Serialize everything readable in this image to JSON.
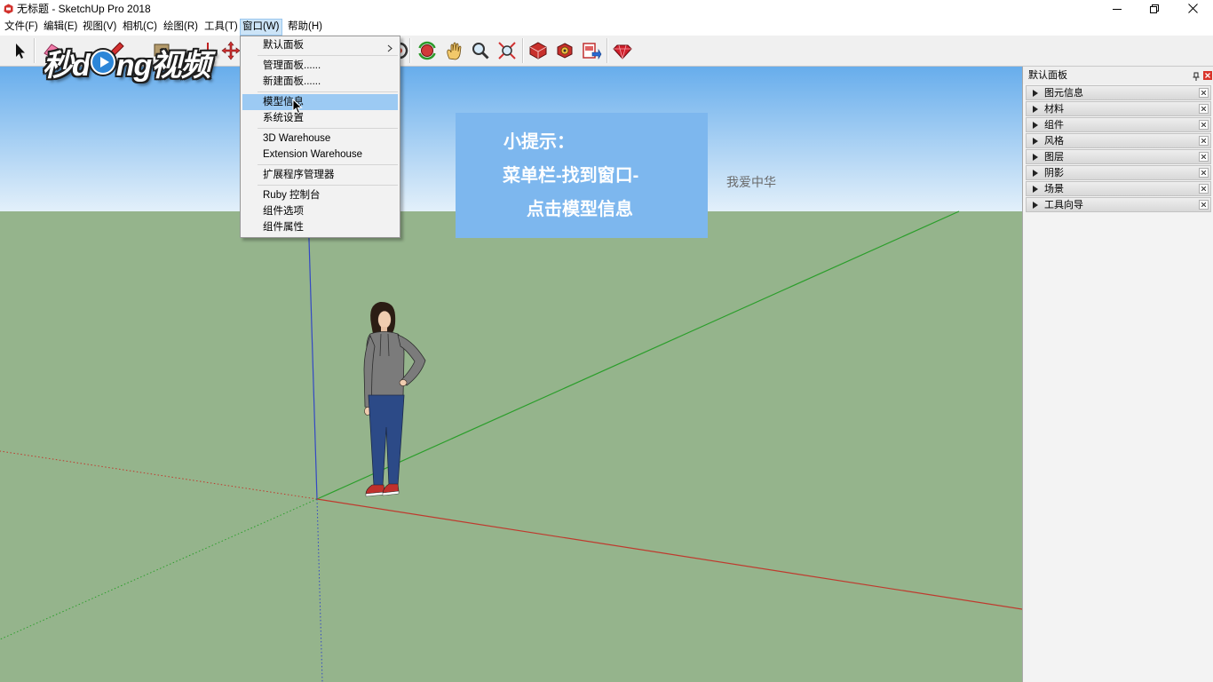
{
  "window": {
    "title": "无标题 - SketchUp Pro 2018",
    "app_icon": "sketchup-logo-icon",
    "controls": [
      "minimize-icon",
      "restore-icon",
      "close-icon"
    ]
  },
  "menubar": {
    "items": [
      {
        "label": "文件(F)"
      },
      {
        "label": "编辑(E)"
      },
      {
        "label": "视图(V)"
      },
      {
        "label": "相机(C)"
      },
      {
        "label": "绘图(R)"
      },
      {
        "label": "工具(T)"
      },
      {
        "label": "窗口(W)",
        "active": true
      },
      {
        "label": "帮助(H)"
      }
    ]
  },
  "window_menu": {
    "items": [
      {
        "label": "默认面板",
        "submenu": true
      },
      {
        "label": "管理面板......"
      },
      {
        "label": "新建面板......"
      },
      {
        "label": "模型信息",
        "highlighted": true
      },
      {
        "label": "系统设置"
      },
      {
        "label": "3D Warehouse"
      },
      {
        "label": "Extension Warehouse"
      },
      {
        "label": "扩展程序管理器"
      },
      {
        "label": "Ruby 控制台"
      },
      {
        "label": "组件选项"
      },
      {
        "label": "组件属性"
      }
    ]
  },
  "toolbar": {
    "icons": [
      "select-icon",
      "eraser-icon",
      "pencil-icon",
      "rectangle-icon",
      "push-pull-icon",
      "move-icon",
      "offset-icon",
      "orbit-icon",
      "pan-icon",
      "zoom-icon",
      "zoom-extents-icon",
      "3d-warehouse-icon",
      "share-component-icon",
      "send-to-layout-icon",
      "extension-warehouse-icon"
    ]
  },
  "watermark": {
    "part1": "秒d",
    "part2": "ng视频"
  },
  "tip": {
    "title": "小提示：",
    "lines": [
      "菜单栏-找到窗口-",
      "点击模型信息"
    ]
  },
  "canvas_note": "我爱中华",
  "tray": {
    "title": "默认面板",
    "panels": [
      {
        "label": "图元信息"
      },
      {
        "label": "材料"
      },
      {
        "label": "组件"
      },
      {
        "label": "风格"
      },
      {
        "label": "图层"
      },
      {
        "label": "阴影"
      },
      {
        "label": "场景"
      },
      {
        "label": "工具向导"
      }
    ]
  },
  "colors": {
    "sky_top": "#67adec",
    "sky_bottom": "#e3f0fa",
    "ground": "#95b48c",
    "menu_highlight": "#9ccaf3",
    "menubar_active": "#cce4f7",
    "tip_bg": "#7db7ee",
    "axis_red": "#bf3a2e",
    "axis_green": "#2b9e2b",
    "axis_blue": "#3348c4"
  }
}
